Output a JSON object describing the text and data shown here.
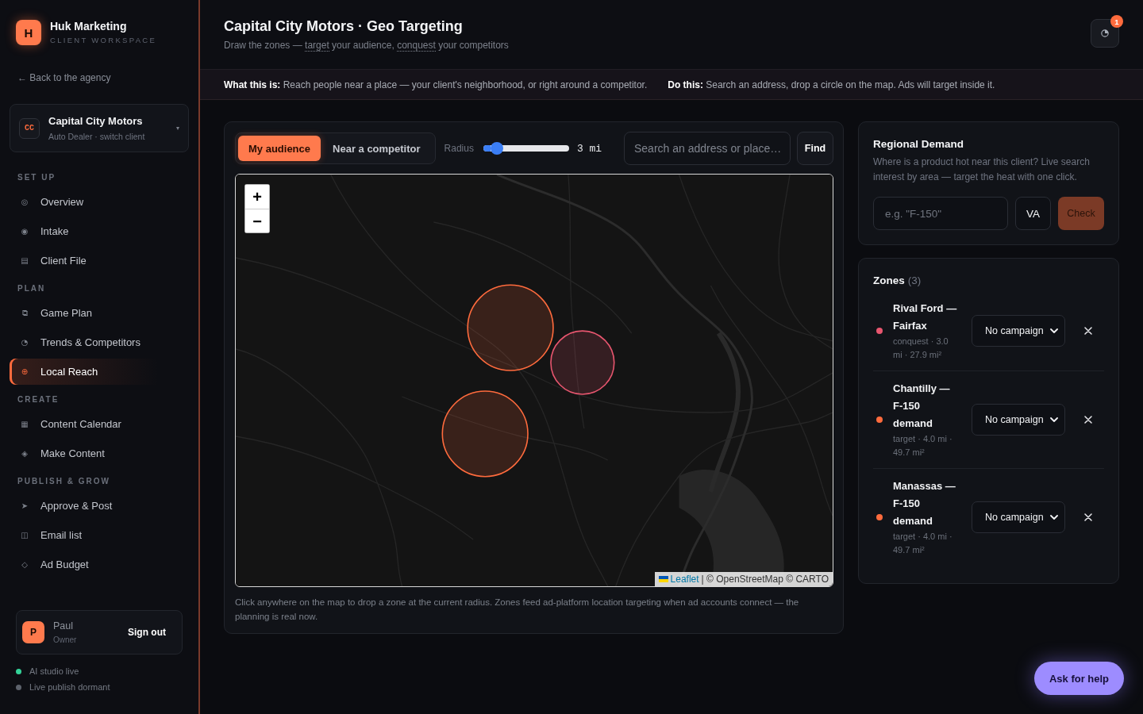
{
  "sidebar": {
    "brand": {
      "logo": "H",
      "name": "Huk Marketing",
      "tagline": "CLIENT WORKSPACE"
    },
    "back_link": "← Back to the agency",
    "client": {
      "badge": "CC",
      "name": "Capital City Motors",
      "subtitle": "Auto Dealer · switch client",
      "caret": "▾"
    },
    "sections": [
      {
        "title": "SET UP",
        "items": [
          {
            "icon": "◎",
            "label": "Overview",
            "selected": false
          },
          {
            "icon": "◉",
            "label": "Intake",
            "selected": false
          },
          {
            "icon": "▤",
            "label": "Client File",
            "selected": false
          }
        ]
      },
      {
        "title": "PLAN",
        "items": [
          {
            "icon": "⧉",
            "label": "Game Plan",
            "selected": false
          },
          {
            "icon": "◔",
            "label": "Trends & Competitors",
            "selected": false
          },
          {
            "icon": "⊕",
            "label": "Local Reach",
            "selected": true
          }
        ]
      },
      {
        "title": "CREATE",
        "items": [
          {
            "icon": "▦",
            "label": "Content Calendar",
            "selected": false
          },
          {
            "icon": "◈",
            "label": "Make Content",
            "selected": false
          }
        ]
      },
      {
        "title": "PUBLISH & GROW",
        "items": [
          {
            "icon": "➤",
            "label": "Approve & Post",
            "selected": false
          },
          {
            "icon": "◫",
            "label": "Email list",
            "selected": false
          },
          {
            "icon": "◇",
            "label": "Ad Budget",
            "selected": false
          }
        ]
      }
    ],
    "user": {
      "avatar": "P",
      "name": "Paul",
      "role": "Owner",
      "sign_out": "Sign out"
    },
    "status": [
      {
        "label": "AI studio live",
        "on": true
      },
      {
        "label": "Live publish dormant",
        "on": false
      }
    ]
  },
  "header": {
    "title": "Capital City Motors · Geo Targeting",
    "subtitle": [
      {
        "kind": "plain",
        "text": "Draw the zones — "
      },
      {
        "kind": "term",
        "text": "target"
      },
      {
        "kind": "plain",
        "text": " your audience, "
      },
      {
        "kind": "term",
        "text": "conquest"
      },
      {
        "kind": "plain",
        "text": " your competitors"
      }
    ],
    "notification_count": "1"
  },
  "info_bar": [
    "**What this is:** Reach people near a place — your client's neighborhood, or right around a competitor.",
    "**Do this:** Search an address, drop a circle on the map. Ads will target inside it."
  ],
  "map_panel": {
    "modes": [
      {
        "label": "My audience",
        "selected": true
      },
      {
        "label": "Near a competitor",
        "selected": false
      }
    ],
    "radius": {
      "label": "Radius",
      "level": 0.1,
      "reading": "3 mi"
    },
    "search": {
      "placeholder": "Search an address or place…",
      "button": "Find"
    },
    "map": {
      "zoom_in": "+",
      "zoom_out": "−",
      "attribution": {
        "link": "Leaflet",
        "text": "| © OpenStreetMap © CARTO"
      }
    },
    "caption": "Click anywhere on the map to drop a zone at the current radius. Zones feed ad-platform location targeting when ad accounts connect — the planning is real now."
  },
  "regional_demand": {
    "title": "Regional Demand",
    "description": "Where is a product hot near this client? Live search interest by area — target the heat with one click.",
    "product_field": {
      "placeholder": "e.g. \"F-150\""
    },
    "region_field": {
      "value": "VA"
    },
    "check_button": {
      "label": "Check",
      "disabled": true
    }
  },
  "zones": {
    "title": "Zones",
    "count": "(3)",
    "items": [
      {
        "name": "Rival Ford — Fairfax",
        "meta": "conquest · 3.0 mi · 27.9 mi²",
        "campaign": "No campaign",
        "color": "#e8566f"
      },
      {
        "name": "Chantilly — F-150 demand",
        "meta": "target · 4.0 mi · 49.7 mi²",
        "campaign": "No campaign",
        "color": "#ff6b3d"
      },
      {
        "name": "Manassas — F-150 demand",
        "meta": "target · 4.0 mi · 49.7 mi²",
        "campaign": "No campaign",
        "color": "#ff6b3d"
      }
    ]
  },
  "help_button": "Ask for help"
}
